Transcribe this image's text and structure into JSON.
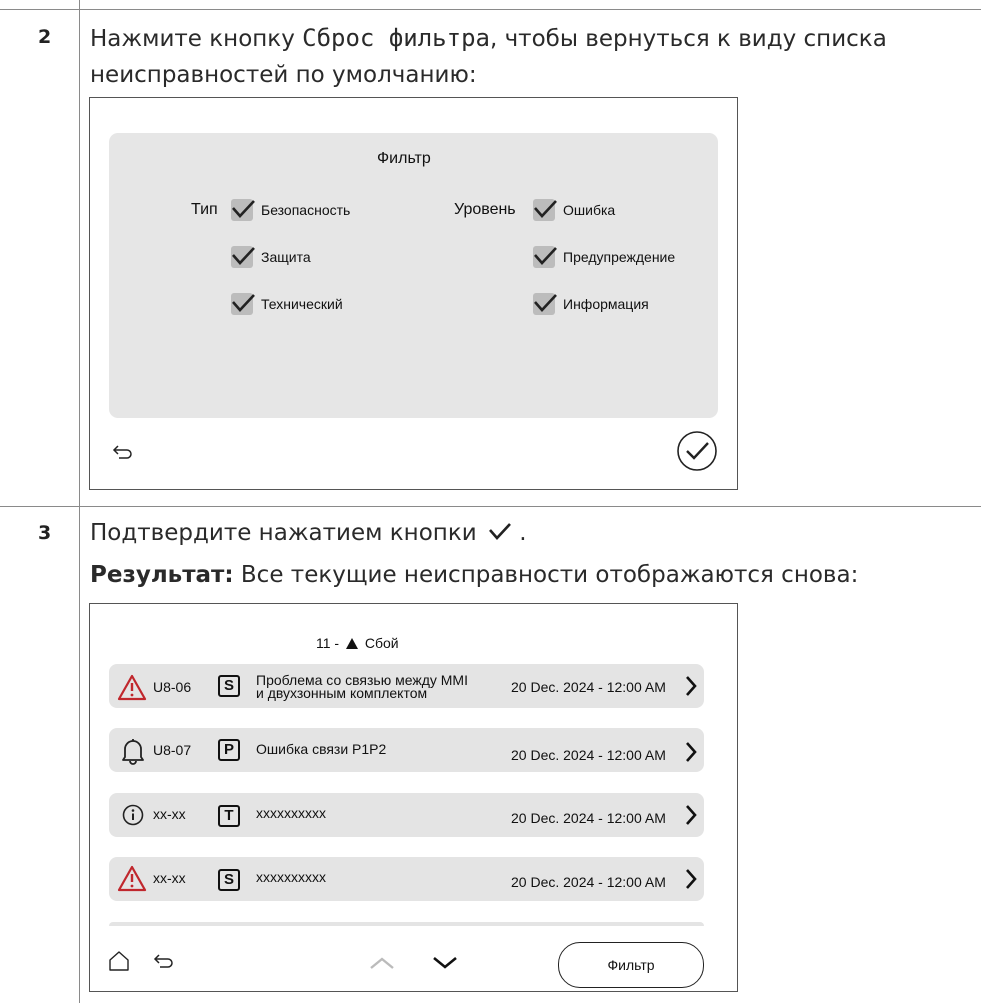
{
  "step2": {
    "number": "2",
    "text_before": "Нажмите кнопку ",
    "button_name": "Сброс фильтра",
    "text_after_line1": ", чтобы вернуться к виду списка",
    "text_line2": "неисправностей по умолчанию:"
  },
  "filter_screen": {
    "title": "Фильтр",
    "type_label": "Тип",
    "level_label": "Уровень",
    "type_options": [
      "Безопасность",
      "Защита",
      "Технический"
    ],
    "level_options": [
      "Ошибка",
      "Предупреждение",
      "Информация"
    ],
    "back_icon": "back-arrow-icon",
    "confirm_icon": "confirm-check-icon"
  },
  "step3": {
    "number": "3",
    "text": "Подтвердите нажатием кнопки",
    "text_end": ".",
    "result_label": "Результат:",
    "result_text": " Все текущие неисправности отображаются снова:"
  },
  "faults_screen": {
    "header_count": "11 -",
    "header_label": "Сбой",
    "rows": [
      {
        "icon": "warning-triangle-icon",
        "code": "U8-06",
        "badge": "S",
        "desc_line1": "Проблема со связью между MMI",
        "desc_line2": "и двухзонным комплектом",
        "date": "20 Dec. 2024 - 12:00 AM"
      },
      {
        "icon": "bell-icon",
        "code": "U8-07",
        "badge": "P",
        "desc_line1": "Ошибка связи P1P2",
        "desc_line2": "",
        "date": "20 Dec. 2024 - 12:00 AM"
      },
      {
        "icon": "info-icon",
        "code": "xx-xx",
        "badge": "T",
        "desc_line1": "xxxxxxxxxx",
        "desc_line2": "",
        "date": "20 Dec. 2024 - 12:00 AM"
      },
      {
        "icon": "warning-triangle-icon",
        "code": "xx-xx",
        "badge": "S",
        "desc_line1": "xxxxxxxxxx",
        "desc_line2": "",
        "date": "20 Dec. 2024 - 12:00 AM"
      }
    ],
    "filter_button": "Фильтр",
    "colors": {
      "warning": "#c0272d",
      "panel": "#e4e4e4"
    }
  }
}
